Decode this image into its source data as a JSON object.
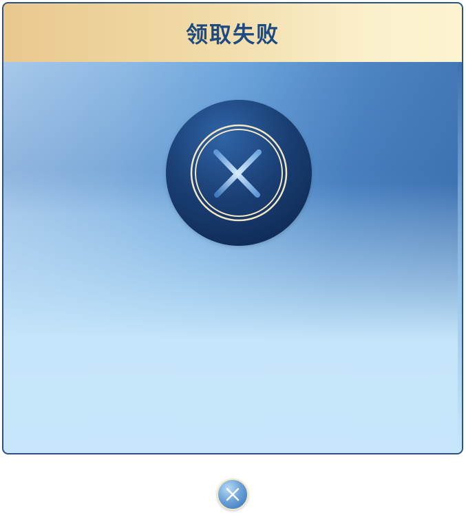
{
  "dialog": {
    "title": "领取失败",
    "status_icon": "error-x-icon",
    "close_icon": "close-icon"
  },
  "colors": {
    "header_gradient_start": "#e9c88e",
    "header_gradient_end": "#fdf3d0",
    "title_color": "#1e4a82",
    "icon_dark_blue": "#0b2249",
    "icon_ring_gold": "#f3e8c2",
    "body_blue": "#6ea6dc",
    "body_light_blue": "#c7e6fb"
  }
}
